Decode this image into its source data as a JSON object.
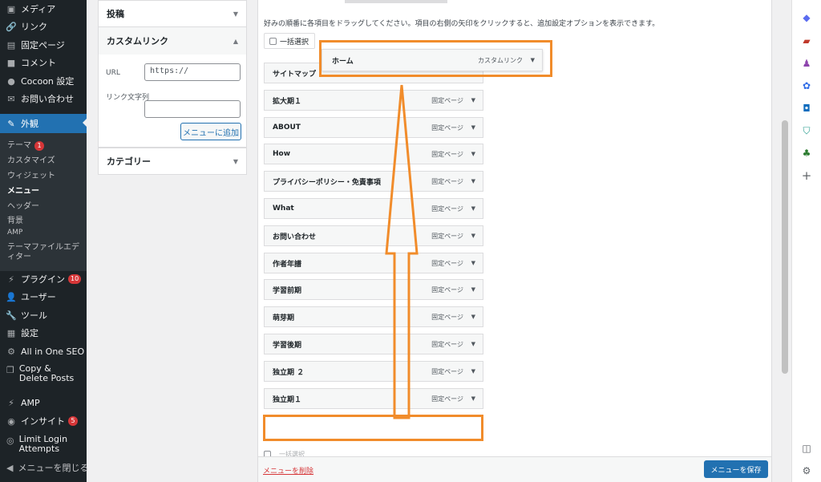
{
  "sidebar": {
    "items": [
      {
        "label": "メディア",
        "icon": "media-icon"
      },
      {
        "label": "リンク",
        "icon": "link-icon"
      },
      {
        "label": "固定ページ",
        "icon": "page-icon"
      },
      {
        "label": "コメント",
        "icon": "comment-icon"
      },
      {
        "label": "Cocoon 設定",
        "icon": "cocoon-icon"
      },
      {
        "label": "お問い合わせ",
        "icon": "mail-icon"
      },
      {
        "label": "外観",
        "icon": "appearance-icon"
      }
    ],
    "submenu": [
      "テーマ",
      "カスタマイズ",
      "ウィジェット",
      "メニュー",
      "ヘッダー",
      "背景",
      "AMP",
      "テーマファイルエディター"
    ],
    "theme_badge": "1",
    "lower_items": [
      {
        "label": "プラグイン",
        "icon": "plugin-icon",
        "badge": "10"
      },
      {
        "label": "ユーザー",
        "icon": "user-icon"
      },
      {
        "label": "ツール",
        "icon": "tool-icon"
      },
      {
        "label": "設定",
        "icon": "settings-icon"
      },
      {
        "label": "All in One SEO",
        "icon": "seo-icon"
      },
      {
        "label": "Copy & Delete Posts",
        "icon": "copy-icon"
      },
      {
        "label": "AMP",
        "icon": "amp-icon"
      },
      {
        "label": "インサイト",
        "icon": "insight-icon",
        "badge": "5"
      },
      {
        "label": "Limit Login Attempts",
        "icon": "fingerprint-icon"
      },
      {
        "label": "メニューを閉じる",
        "icon": "collapse-icon"
      }
    ]
  },
  "panels": {
    "posts": "投稿",
    "custom_link": "カスタムリンク",
    "url_label": "URL",
    "url_value": "https://",
    "link_text_label": "リンク文字列",
    "add_button": "メニューに追加",
    "category": "カテゴリー"
  },
  "structure": {
    "instructions": "好みの順番に各項目をドラッグしてください。項目の右側の矢印をクリックすると、追加設定オプションを表示できます。",
    "bulk_select": "一括選択",
    "dragging_item": {
      "title": "ホーム",
      "type": "カスタムリンク"
    },
    "items": [
      {
        "title": "サイトマップ",
        "type": ""
      },
      {
        "title": "拡大期１",
        "type": "固定ページ"
      },
      {
        "title": "ABOUT",
        "type": "固定ページ"
      },
      {
        "title": "How",
        "type": "固定ページ"
      },
      {
        "title": "プライバシーポリシー・免責事項",
        "type": "固定ページ"
      },
      {
        "title": "What",
        "type": "固定ページ"
      },
      {
        "title": "お問い合わせ",
        "type": "固定ページ"
      },
      {
        "title": "作者年譜",
        "type": "固定ページ"
      },
      {
        "title": "学習前期",
        "type": "固定ページ"
      },
      {
        "title": "萌芽期",
        "type": "固定ページ"
      },
      {
        "title": "学習後期",
        "type": "固定ページ"
      },
      {
        "title": "独立期 ２",
        "type": "固定ページ"
      },
      {
        "title": "独立期１",
        "type": "固定ページ"
      }
    ],
    "bulk_select_bottom": "一括選択",
    "delete_link": "メニューを削除",
    "save_button": "メニューを保存"
  },
  "colors": {
    "admin_bg": "#1d2327",
    "admin_active": "#2271b1",
    "annotation": "#f18c2b",
    "primary_button": "#2271b1"
  }
}
